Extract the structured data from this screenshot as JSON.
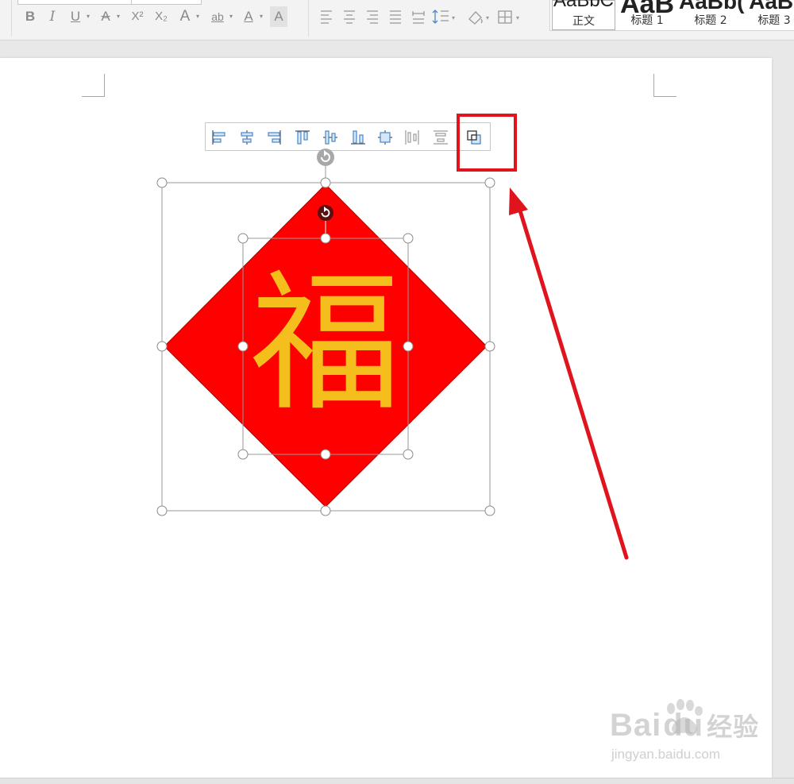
{
  "ribbon": {
    "format_buttons": [
      {
        "name": "bold-button",
        "glyph": "B"
      },
      {
        "name": "italic-button",
        "glyph": "I"
      },
      {
        "name": "underline-button",
        "glyph": "U"
      },
      {
        "name": "strikethrough-button",
        "glyph": "A"
      },
      {
        "name": "superscript-button",
        "glyph": "X²"
      },
      {
        "name": "subscript-button",
        "glyph": "X₂"
      },
      {
        "name": "text-effect-button",
        "glyph": "A"
      },
      {
        "name": "highlight-button",
        "glyph": "ab"
      },
      {
        "name": "font-color-button",
        "glyph": "A"
      },
      {
        "name": "char-shading-button",
        "glyph": "A"
      }
    ],
    "styles": [
      {
        "preview": "AaBbC",
        "label": "正文"
      },
      {
        "preview": "AaB",
        "label": "标题 1"
      },
      {
        "preview": "AaBb(",
        "label": "标题 2"
      },
      {
        "preview": "AaBl",
        "label": "标题 3"
      }
    ]
  },
  "drawing": {
    "character": "福",
    "diamond_color": "#ff0000",
    "character_color": "#f4be1c"
  },
  "callout": {
    "color": "#e0141c"
  },
  "watermark": {
    "brand": "Bai",
    "brand_tail": "du",
    "suffix": "经验",
    "url": "jingyan.baidu.com"
  }
}
